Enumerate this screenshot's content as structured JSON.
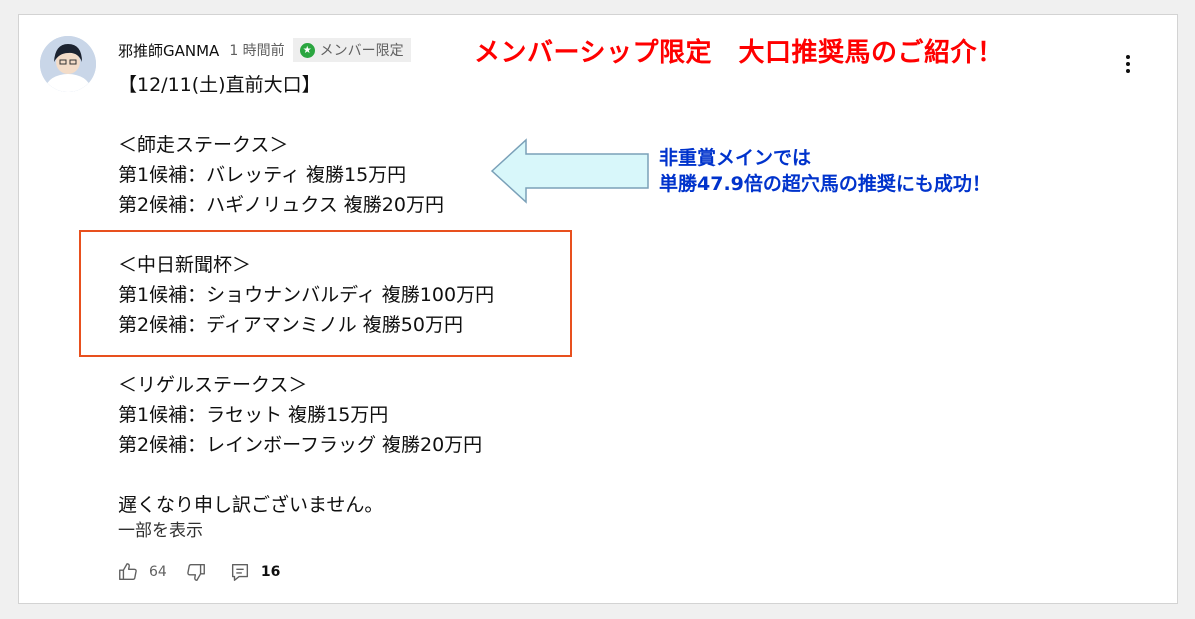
{
  "colors": {
    "accent_red": "#ff0000",
    "note_blue": "#0033cc",
    "box_orange": "#e8501e",
    "arrow_fill": "#d8f7fa",
    "arrow_stroke": "#7aa0b8",
    "member_green": "#2ba640"
  },
  "comment": {
    "author": "邪推師GANMA",
    "time": "1 時間前",
    "badge_label": "メンバー限定",
    "badge_icon": "star-icon",
    "headline": "メンバーシップ限定　大口推奨馬のご紹介！",
    "lines": {
      "date": "【12/11(土)直前大口】",
      "race_a_title": "＜師走ステークス＞",
      "race_a_1": "第1候補：バレッティ 複勝15万円",
      "race_a_2": "第2候補：ハギノリュクス 複勝20万円",
      "race_b_title": "＜中日新聞杯＞",
      "race_b_1": "第1候補：ショウナンバルディ 複勝100万円",
      "race_b_2": "第2候補：ディアマンミノル 複勝50万円",
      "race_c_title": "＜リゲルステークス＞",
      "race_c_1": "第1候補：ラセット 複勝15万円",
      "race_c_2": "第2候補：レインボーフラッグ 複勝20万円",
      "apology": "遅くなり申し訳ございません。"
    },
    "show_more": "一部を表示",
    "note_line1": "非重賞メインでは",
    "note_line2": "単勝47.9倍の超穴馬の推奨にも成功！",
    "like_count": "64",
    "reply_count": "16"
  }
}
